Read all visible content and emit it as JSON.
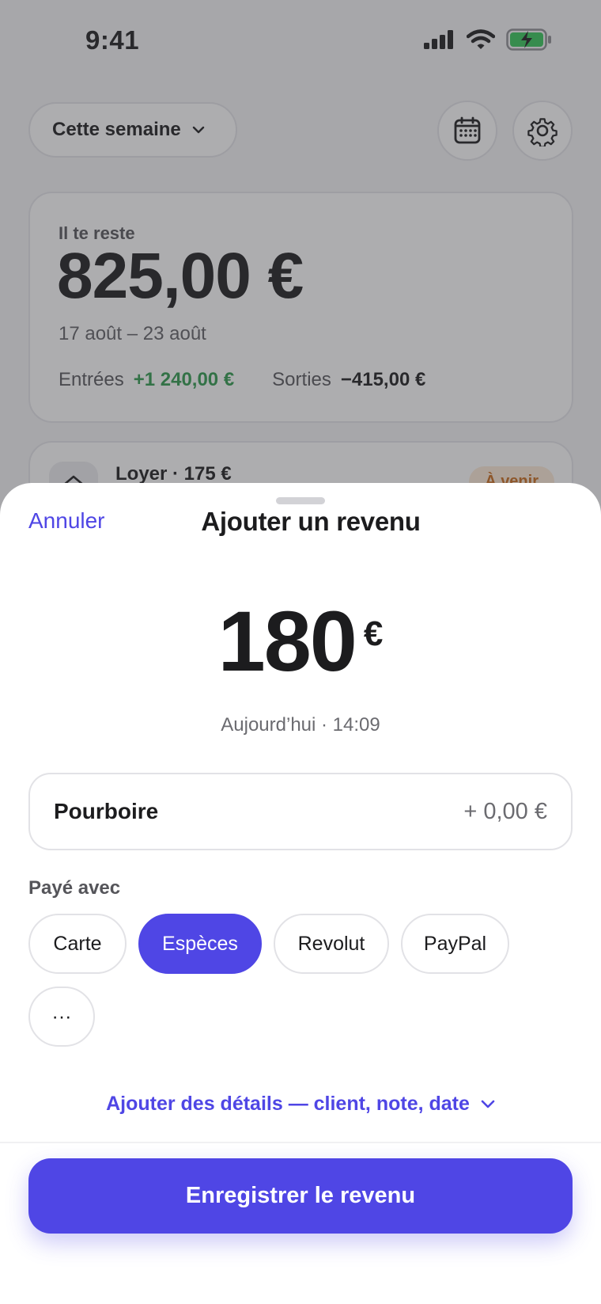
{
  "status_bar": {
    "time": "9:41"
  },
  "background": {
    "period_selector": {
      "label": "Cette semaine"
    },
    "summary_card": {
      "label": "Il te reste",
      "amount": "825,00 €",
      "date_range": "17 août – 23 août",
      "income_label": "Entrées",
      "income_value": "+1 240,00 €",
      "expense_label": "Sorties",
      "expense_value": "−415,00 €"
    },
    "upcoming_item": {
      "title": "Loyer · 175 €",
      "badge": "À venir"
    }
  },
  "sheet": {
    "cancel_label": "Annuler",
    "title": "Ajouter un revenu",
    "amount": "180",
    "currency": "€",
    "timestamp": "Aujourd’hui · 14:09",
    "tip": {
      "label": "Pourboire",
      "value": "+ 0,00 €"
    },
    "payment": {
      "label": "Payé avec",
      "options": [
        "Carte",
        "Espèces",
        "Revolut",
        "PayPal",
        "···"
      ],
      "selected": "Espèces"
    },
    "details_link": "Ajouter des détails — client, note, date",
    "save_label": "Enregistrer le revenu"
  },
  "colors": {
    "accent": "#4f46e5",
    "income_green": "#2e9a4c",
    "battery_green": "#34c759"
  }
}
